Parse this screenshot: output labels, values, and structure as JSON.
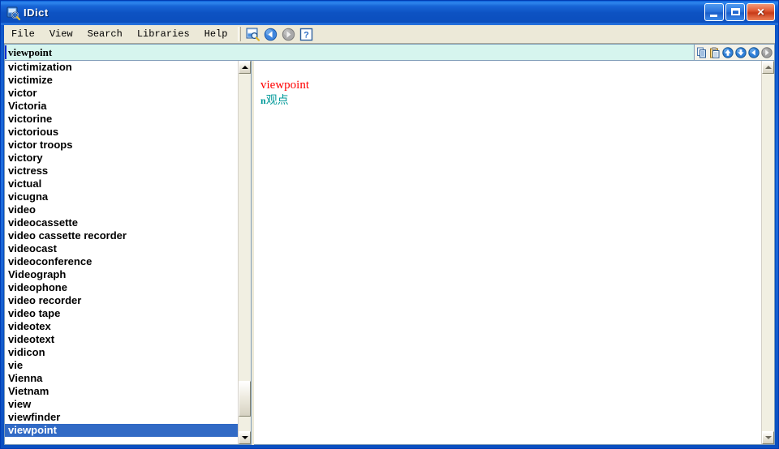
{
  "window": {
    "title": "IDict",
    "icon": "dictionary-book-icon",
    "controls": {
      "minimize": "Minimize",
      "maximize": "Maximize",
      "close": "Close",
      "close_glyph": "✕"
    }
  },
  "menu": {
    "items": [
      {
        "label": "File",
        "name": "menu-file"
      },
      {
        "label": "View",
        "name": "menu-view"
      },
      {
        "label": "Search",
        "name": "menu-search"
      },
      {
        "label": "Libraries",
        "name": "menu-libraries"
      },
      {
        "label": "Help",
        "name": "menu-help"
      }
    ]
  },
  "toolbar": {
    "buttons": [
      {
        "name": "search-dictionary-icon",
        "title": "Search"
      },
      {
        "name": "back-arrow-icon",
        "title": "Back"
      },
      {
        "name": "forward-arrow-icon",
        "title": "Forward"
      },
      {
        "name": "help-question-icon",
        "title": "Help"
      }
    ]
  },
  "search": {
    "value": "viewpoint",
    "placeholder": "",
    "buttons": [
      {
        "name": "copy-icon",
        "title": "Copy"
      },
      {
        "name": "paste-icon",
        "title": "Paste"
      },
      {
        "name": "scroll-up-icon",
        "title": "Previous"
      },
      {
        "name": "scroll-down-icon",
        "title": "Next"
      },
      {
        "name": "history-back-icon",
        "title": "Back"
      },
      {
        "name": "history-forward-icon",
        "title": "Forward"
      }
    ]
  },
  "wordlist": {
    "selected": "viewpoint",
    "items": [
      "victimization",
      "victimize",
      "victor",
      "Victoria",
      "victorine",
      "victorious",
      "victor troops",
      "victory",
      "victress",
      "victual",
      "vicugna",
      "video",
      "videocassette",
      "video cassette recorder",
      "videocast",
      "videoconference",
      "Videograph",
      "videophone",
      "video recorder",
      "video tape",
      "videotex",
      "videotext",
      "vidicon",
      "vie",
      "Vienna",
      "Vietnam",
      "view",
      "viewfinder",
      "viewpoint"
    ]
  },
  "definition": {
    "headword": "viewpoint",
    "part_of_speech": "n",
    "meaning": "观点"
  },
  "colors": {
    "titlebar_blue": "#0a53c6",
    "selection_blue": "#316ac5",
    "headword_red": "#ff0000",
    "meaning_teal": "#009999",
    "search_field_bg": "#d6f5ee",
    "chrome_beige": "#ece9d8"
  },
  "scrollbars": {
    "list": {
      "up": "▲",
      "down": "▼"
    },
    "definition": {
      "up": "▲",
      "down": "▼"
    }
  }
}
